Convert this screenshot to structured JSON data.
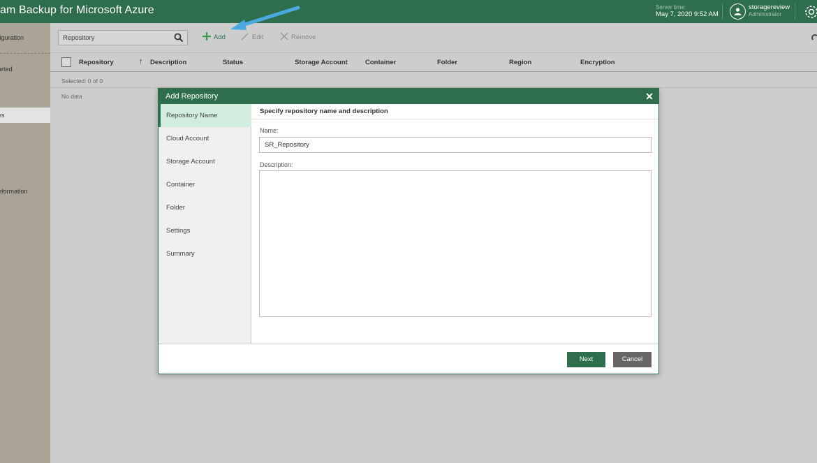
{
  "header": {
    "app_title": "am Backup for Microsoft Azure",
    "server_time_label": "Server time:",
    "server_time_value": "May 7, 2020 9:52 AM",
    "user_name": "storagereview",
    "user_role": "Administrator"
  },
  "sidebar": {
    "items": [
      {
        "label": "figuration"
      },
      {
        "label": "arted"
      },
      {
        "label": "es"
      },
      {
        "label": "nformation"
      }
    ]
  },
  "toolbar": {
    "search_value": "Repository",
    "add_label": "Add",
    "edit_label": "Edit",
    "remove_label": "Remove"
  },
  "grid": {
    "columns": [
      "Repository",
      "Description",
      "Status",
      "Storage Account",
      "Container",
      "Folder",
      "Region",
      "Encryption"
    ],
    "selected_text": "Selected:  0 of 0",
    "empty_text": "No data"
  },
  "dialog": {
    "title": "Add Repository",
    "steps": [
      "Repository Name",
      "Cloud Account",
      "Storage Account",
      "Container",
      "Folder",
      "Settings",
      "Summary"
    ],
    "active_step": 0,
    "section_title": "Specify repository name and description",
    "name_label": "Name:",
    "name_value": "SR_Repository",
    "description_label": "Description:",
    "description_value": "",
    "next_label": "Next",
    "cancel_label": "Cancel"
  },
  "colors": {
    "brand_green": "#2e6e4d",
    "active_step_bg": "#d0eddd",
    "annotation_arrow": "#4aa9e0"
  }
}
